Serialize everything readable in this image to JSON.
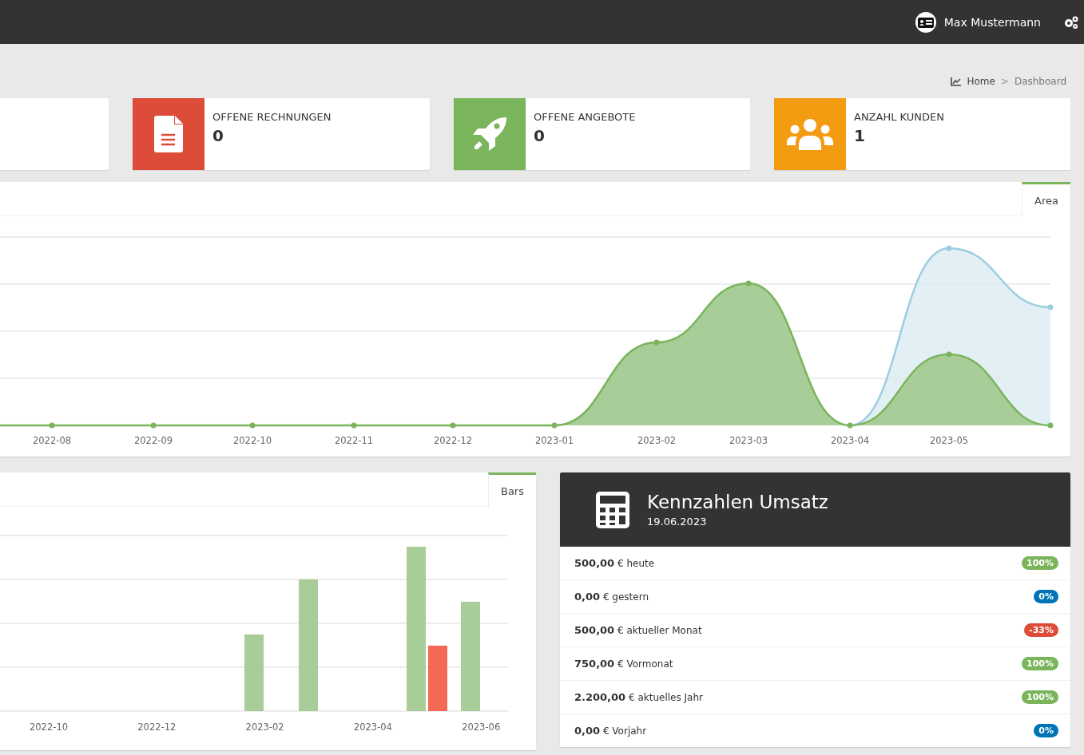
{
  "topbar": {
    "user_name": "Max Mustermann"
  },
  "breadcrumb_separator": ">",
  "breadcrumb": [
    {
      "label": "Home",
      "active": false
    },
    {
      "label": "Dashboard",
      "active": true
    }
  ],
  "stat_cards": [
    {
      "kind": "blank"
    },
    {
      "kind": "invoice",
      "color": "#dd4b39",
      "label": "OFFENE RECHNUNGEN",
      "value": "0"
    },
    {
      "kind": "offer",
      "color": "#7ab55c",
      "label": "OFFENE ANGEBOTE",
      "value": "0"
    },
    {
      "kind": "customers",
      "color": "#f39c12",
      "label": "ANZAHL KUNDEN",
      "value": "1"
    }
  ],
  "area_panel": {
    "tab": {
      "label": "Area",
      "selected": true
    },
    "x_labels": [
      "2022-08",
      "2022-09",
      "2022-10",
      "2022-11",
      "2022-12",
      "2023-01",
      "2023-02",
      "2023-03",
      "2023-04",
      "2023-05"
    ]
  },
  "bars_panel": {
    "tab": {
      "label": "Bars",
      "selected": true
    },
    "x_labels": [
      "2022-10",
      "2022-12",
      "2023-02",
      "2023-04",
      "2023-06"
    ]
  },
  "kpi_panel": {
    "title": "Kennzahlen Umsatz",
    "date": "19.06.2023",
    "rows": [
      {
        "amount": "500,00",
        "label": "€ heute",
        "badge": "100%",
        "color": "#7ab55c"
      },
      {
        "amount": "0,00",
        "label": "€ gestern",
        "badge": "0%",
        "color": "#0073b7"
      },
      {
        "amount": "500,00",
        "label": "€ aktueller Monat",
        "badge": "-33%",
        "color": "#dd4b39"
      },
      {
        "amount": "750,00",
        "label": "€ Vormonat",
        "badge": "100%",
        "color": "#7ab55c"
      },
      {
        "amount": "2.200,00",
        "label": "€ aktuelles Jahr",
        "badge": "100%",
        "color": "#7ab55c"
      },
      {
        "amount": "0,00",
        "label": "€ Vorjahr",
        "badge": "0%",
        "color": "#0073b7"
      }
    ]
  }
}
